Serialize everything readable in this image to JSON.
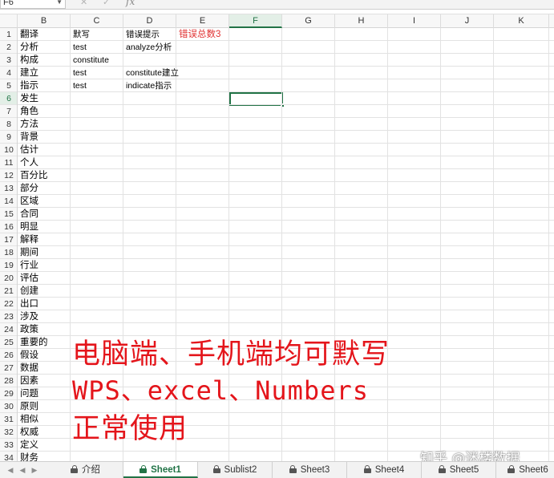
{
  "formula_bar": {
    "name_box": "F6",
    "cancel_icon": "✕",
    "accept_icon": "✓",
    "fx": "fx"
  },
  "columns": [
    "B",
    "C",
    "D",
    "E",
    "F",
    "G",
    "H",
    "I",
    "J",
    "K"
  ],
  "active_column": "F",
  "active_row": 6,
  "rows": [
    {
      "num": "1",
      "B": "翻译",
      "C": "默写",
      "D": "错误提示",
      "E": "错误总数3"
    },
    {
      "num": "2",
      "B": "分析",
      "C": "test",
      "D": "analyze分析"
    },
    {
      "num": "3",
      "B": "构成",
      "C": "constitute"
    },
    {
      "num": "4",
      "B": "建立",
      "C": "test",
      "D": "constitute建立"
    },
    {
      "num": "5",
      "B": "指示",
      "C": "test",
      "D": "indicate指示"
    },
    {
      "num": "6",
      "B": "发生"
    },
    {
      "num": "7",
      "B": "角色"
    },
    {
      "num": "8",
      "B": "方法"
    },
    {
      "num": "9",
      "B": "背景"
    },
    {
      "num": "10",
      "B": "估计"
    },
    {
      "num": "11",
      "B": "个人"
    },
    {
      "num": "12",
      "B": "百分比"
    },
    {
      "num": "13",
      "B": "部分"
    },
    {
      "num": "14",
      "B": "区域"
    },
    {
      "num": "15",
      "B": "合同"
    },
    {
      "num": "16",
      "B": "明显"
    },
    {
      "num": "17",
      "B": "解释"
    },
    {
      "num": "18",
      "B": "期间"
    },
    {
      "num": "19",
      "B": "行业"
    },
    {
      "num": "20",
      "B": "评估"
    },
    {
      "num": "21",
      "B": "创建"
    },
    {
      "num": "22",
      "B": "出口"
    },
    {
      "num": "23",
      "B": "涉及"
    },
    {
      "num": "24",
      "B": "政策"
    },
    {
      "num": "25",
      "B": "重要的"
    },
    {
      "num": "26",
      "B": "假设"
    },
    {
      "num": "27",
      "B": "数据"
    },
    {
      "num": "28",
      "B": "因素"
    },
    {
      "num": "29",
      "B": "问题"
    },
    {
      "num": "30",
      "B": "原则"
    },
    {
      "num": "31",
      "B": "相似"
    },
    {
      "num": "32",
      "B": "权威"
    },
    {
      "num": "33",
      "B": "定义"
    },
    {
      "num": "34",
      "B": "财务"
    }
  ],
  "overlay": {
    "line1": "电脑端、手机端均可默写",
    "line2": "WPS、excel、Numbers",
    "line3": "正常使用"
  },
  "tabs": {
    "nav_first": "◀",
    "nav_prev": "◀",
    "nav_next": "▶",
    "items": [
      "介绍",
      "Sheet1",
      "Sublist2",
      "Sheet3",
      "Sheet4",
      "Sheet5",
      "Sheet6"
    ],
    "active": "Sheet1"
  },
  "watermark": "知乎 @迷楼数据",
  "colors": {
    "accent_green": "#217346",
    "error_red": "#e03131",
    "overlay_red": "#e4151b"
  }
}
